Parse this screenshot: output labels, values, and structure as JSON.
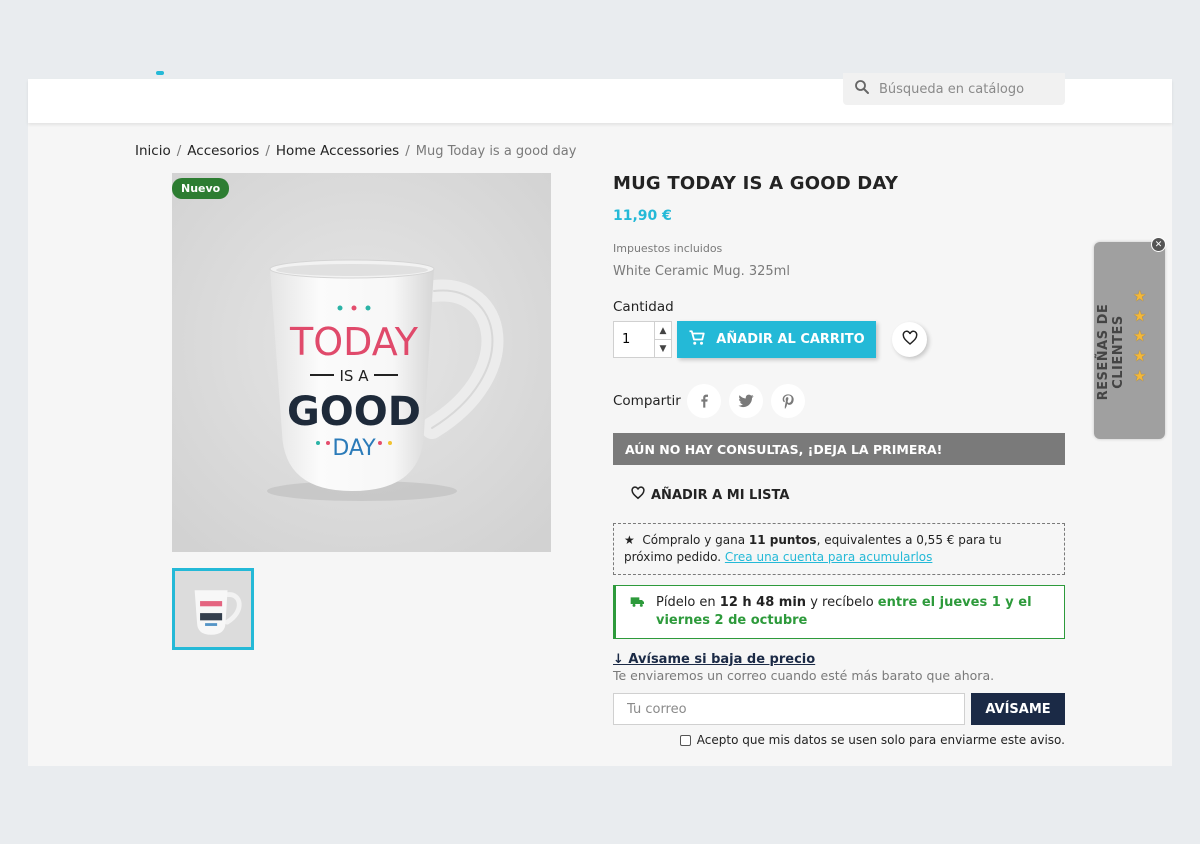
{
  "header": {
    "search_placeholder": "Búsqueda en catálogo"
  },
  "breadcrumb": {
    "items": [
      "Inicio",
      "Accesorios",
      "Home Accessories"
    ],
    "separator": "/",
    "current": "Mug Today is a good day"
  },
  "product": {
    "badge": "Nuevo",
    "title": "MUG TODAY IS A GOOD DAY",
    "price": "11,90 €",
    "tax_note": "Impuestos incluidos",
    "description": "White Ceramic Mug. 325ml",
    "mug_text": {
      "line1": "TODAY",
      "line2": "IS A",
      "line3": "GOOD",
      "line4": "DAY"
    },
    "quantity_label": "Cantidad",
    "quantity_value": "1",
    "add_to_cart": "AÑADIR AL CARRITO",
    "share_label": "Compartir",
    "consult_bar": "AÚN NO HAY CONSULTAS, ¡DEJA LA PRIMERA!",
    "add_wishlist": "AÑADIR A MI LISTA"
  },
  "points": {
    "star": "★",
    "prefix": "Cómpralo y gana ",
    "points": "11 puntos",
    "suffix": ", equivalentes a 0,55 € para tu próximo pedido. ",
    "link": "Crea una cuenta para acumularlos"
  },
  "delivery": {
    "prefix": "Pídelo en ",
    "time": "12 h 48 min",
    "middle": " y recíbelo ",
    "window": "entre el jueves 1 y el viernes 2 de octubre"
  },
  "price_alert": {
    "link": "↓ Avísame si baja de precio",
    "description": "Te enviaremos un correo cuando esté más barato que ahora.",
    "email_placeholder": "Tu correo",
    "button": "AVÍSAME",
    "consent": "Acepto que mis datos se usen solo para enviarme este aviso."
  },
  "reviews_tab": {
    "label": "RESEÑAS DE CLIENTES",
    "close": "✕"
  },
  "colors": {
    "accent": "#24b9d7",
    "badge_green": "#2d7d32",
    "dark_button": "#1b2a46",
    "consult_bar": "#7a7a7a"
  }
}
